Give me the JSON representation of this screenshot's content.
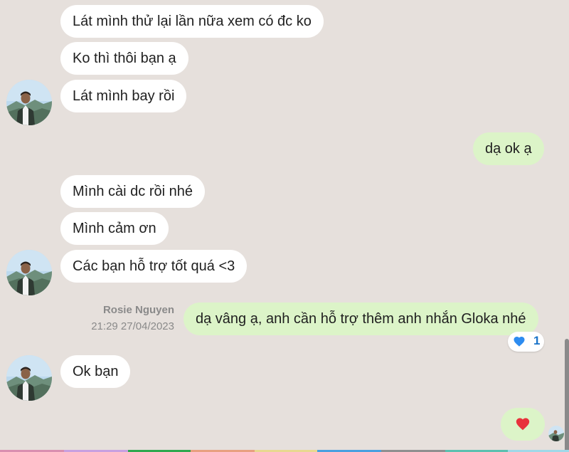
{
  "messages": {
    "m1": "Lát mình thử lại lần nữa xem có đc ko",
    "m2": "Ko thì thôi bạn ạ",
    "m3": "Lát mình bay rồi",
    "m4": "dạ ok ạ",
    "m5": "Mình cài dc rồi nhé",
    "m6": "Mình cảm ơn",
    "m7": "Các bạn hỗ trợ tốt quá <3",
    "m8": "dạ vâng ạ, anh cần hỗ trợ thêm anh nhắn Gloka nhé",
    "m9": "Ok bạn"
  },
  "sender_meta": {
    "name": "Rosie Nguyen",
    "timestamp": "21:29 27/04/2023"
  },
  "reaction": {
    "icon": "heart-icon",
    "count": "1",
    "color": "#2d8cf0"
  },
  "last_reaction": {
    "icon": "heart-icon",
    "color": "#e8323c"
  },
  "colors": {
    "incoming_bubble": "#ffffff",
    "outgoing_bubble": "#dcf4c8",
    "background": "#e6e0dc"
  }
}
